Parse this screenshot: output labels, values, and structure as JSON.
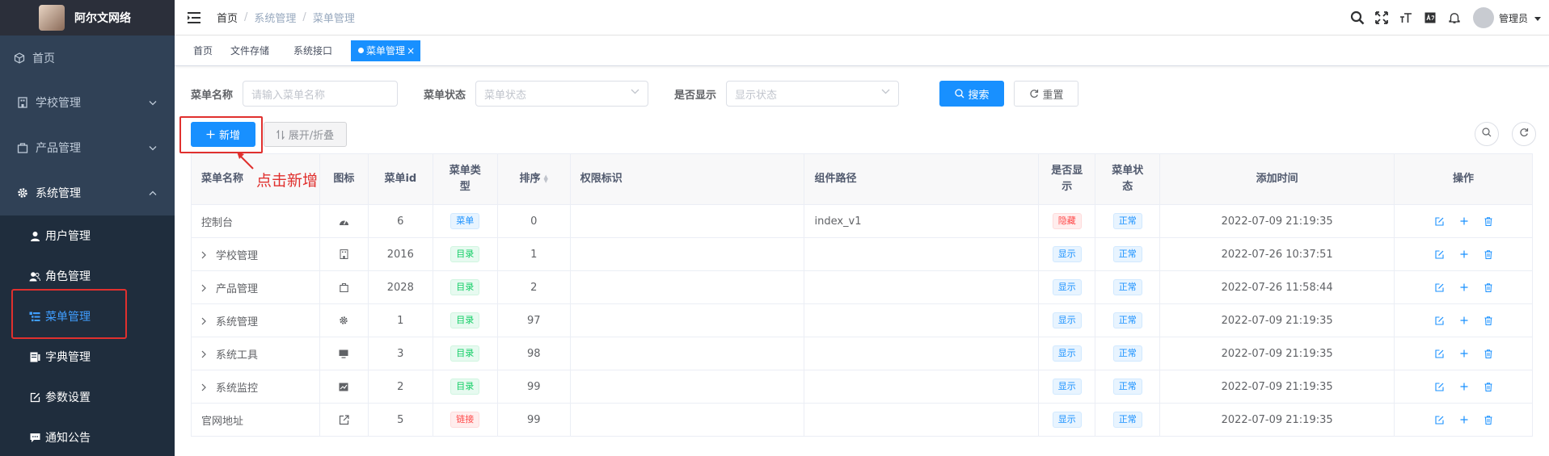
{
  "sidebar": {
    "logo_title": "阿尔文网络",
    "items": [
      {
        "label": "首页",
        "icon": "cube-icon"
      },
      {
        "label": "学校管理",
        "icon": "building-icon"
      },
      {
        "label": "产品管理",
        "icon": "bag-icon"
      },
      {
        "label": "系统管理",
        "icon": "gear-icon"
      }
    ],
    "subitems": [
      {
        "label": "用户管理",
        "icon": "user-icon"
      },
      {
        "label": "角色管理",
        "icon": "users-icon"
      },
      {
        "label": "菜单管理",
        "icon": "tree-table-icon"
      },
      {
        "label": "字典管理",
        "icon": "dict-icon"
      },
      {
        "label": "参数设置",
        "icon": "edit-icon"
      },
      {
        "label": "通知公告",
        "icon": "message-icon"
      }
    ]
  },
  "navbar": {
    "breadcrumb": [
      "首页",
      "系统管理",
      "菜单管理"
    ],
    "separator": "/",
    "user_name": "管理员"
  },
  "tags": [
    "首页",
    "文件存储",
    "系统接口",
    "菜单管理"
  ],
  "search": {
    "menu_name_label": "菜单名称",
    "menu_name_placeholder": "请输入菜单名称",
    "menu_status_label": "菜单状态",
    "menu_status_placeholder": "菜单状态",
    "visible_label": "是否显示",
    "visible_placeholder": "显示状态",
    "search_btn": "搜索",
    "reset_btn": "重置"
  },
  "toolbar": {
    "add_btn": "新增",
    "toggle_btn": "展开/折叠"
  },
  "annotation": "点击新增",
  "table": {
    "headers": [
      "菜单名称",
      "图标",
      "菜单id",
      "菜单类型",
      "排序",
      "权限标识",
      "组件路径",
      "是否显示",
      "菜单状态",
      "添加时间",
      "操作"
    ],
    "rows": [
      {
        "name": "控制台",
        "expand": false,
        "icon": "dashboard-icon",
        "id": "6",
        "type": "菜单",
        "type_color": "blue",
        "order": "0",
        "perm": "",
        "component": "index_v1",
        "visible": "隐藏",
        "visible_color": "red",
        "status": "正常",
        "time": "2022-07-09 21:19:35"
      },
      {
        "name": "学校管理",
        "expand": true,
        "icon": "building-icon",
        "id": "2016",
        "type": "目录",
        "type_color": "green",
        "order": "1",
        "perm": "",
        "component": "",
        "visible": "显示",
        "visible_color": "blue",
        "status": "正常",
        "time": "2022-07-26 10:37:51"
      },
      {
        "name": "产品管理",
        "expand": true,
        "icon": "bag-icon",
        "id": "2028",
        "type": "目录",
        "type_color": "green",
        "order": "2",
        "perm": "",
        "component": "",
        "visible": "显示",
        "visible_color": "blue",
        "status": "正常",
        "time": "2022-07-26 11:58:44"
      },
      {
        "name": "系统管理",
        "expand": true,
        "icon": "gear-icon",
        "id": "1",
        "type": "目录",
        "type_color": "green",
        "order": "97",
        "perm": "",
        "component": "",
        "visible": "显示",
        "visible_color": "blue",
        "status": "正常",
        "time": "2022-07-09 21:19:35"
      },
      {
        "name": "系统工具",
        "expand": true,
        "icon": "monitor-icon",
        "id": "3",
        "type": "目录",
        "type_color": "green",
        "order": "98",
        "perm": "",
        "component": "",
        "visible": "显示",
        "visible_color": "blue",
        "status": "正常",
        "time": "2022-07-09 21:19:35"
      },
      {
        "name": "系统监控",
        "expand": true,
        "icon": "chart-icon",
        "id": "2",
        "type": "目录",
        "type_color": "green",
        "order": "99",
        "perm": "",
        "component": "",
        "visible": "显示",
        "visible_color": "blue",
        "status": "正常",
        "time": "2022-07-09 21:19:35"
      },
      {
        "name": "官网地址",
        "expand": false,
        "icon": "external-link-icon",
        "id": "5",
        "type": "链接",
        "type_color": "red",
        "order": "99",
        "perm": "",
        "component": "",
        "visible": "显示",
        "visible_color": "blue",
        "status": "正常",
        "time": "2022-07-09 21:19:35"
      }
    ]
  },
  "colors": {
    "primary": "#1890ff",
    "sidebar_bg": "#304156",
    "annotation": "#e0302e"
  }
}
